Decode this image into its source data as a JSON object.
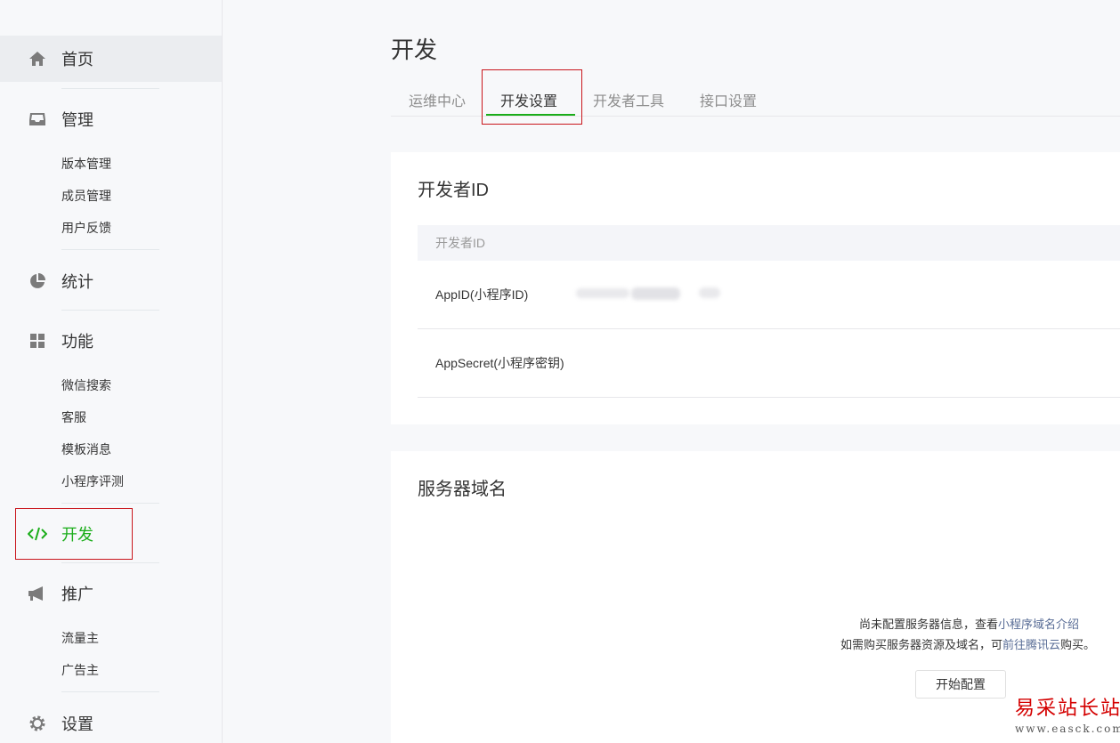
{
  "sidebar": {
    "home": "首页",
    "manage": {
      "label": "管理",
      "items": [
        "版本管理",
        "成员管理",
        "用户反馈"
      ]
    },
    "stats": "统计",
    "features": {
      "label": "功能",
      "items": [
        "微信搜索",
        "客服",
        "模板消息",
        "小程序评测"
      ]
    },
    "dev": "开发",
    "promote": {
      "label": "推广",
      "items": [
        "流量主",
        "广告主"
      ]
    },
    "settings": "设置",
    "accent": "#1aad19"
  },
  "main": {
    "title": "开发",
    "tabs": [
      "运维中心",
      "开发设置",
      "开发者工具",
      "接口设置"
    ],
    "active_tab": "开发设置"
  },
  "developer_id": {
    "title": "开发者ID",
    "header": "开发者ID",
    "rows": [
      {
        "label": "AppID(小程序ID)"
      },
      {
        "label": "AppSecret(小程序密钥)"
      }
    ]
  },
  "server_domain": {
    "title": "服务器域名",
    "tip1_prefix": "尚未配置服务器信息，查看",
    "tip1_link": "小程序域名介绍",
    "tip2_prefix": "如需购买服务器资源及域名，可",
    "tip2_link": "前往腾讯云",
    "tip2_suffix": "购买。",
    "button": "开始配置"
  },
  "watermark": {
    "text": "易采站长站",
    "url": "www.easck.com"
  }
}
